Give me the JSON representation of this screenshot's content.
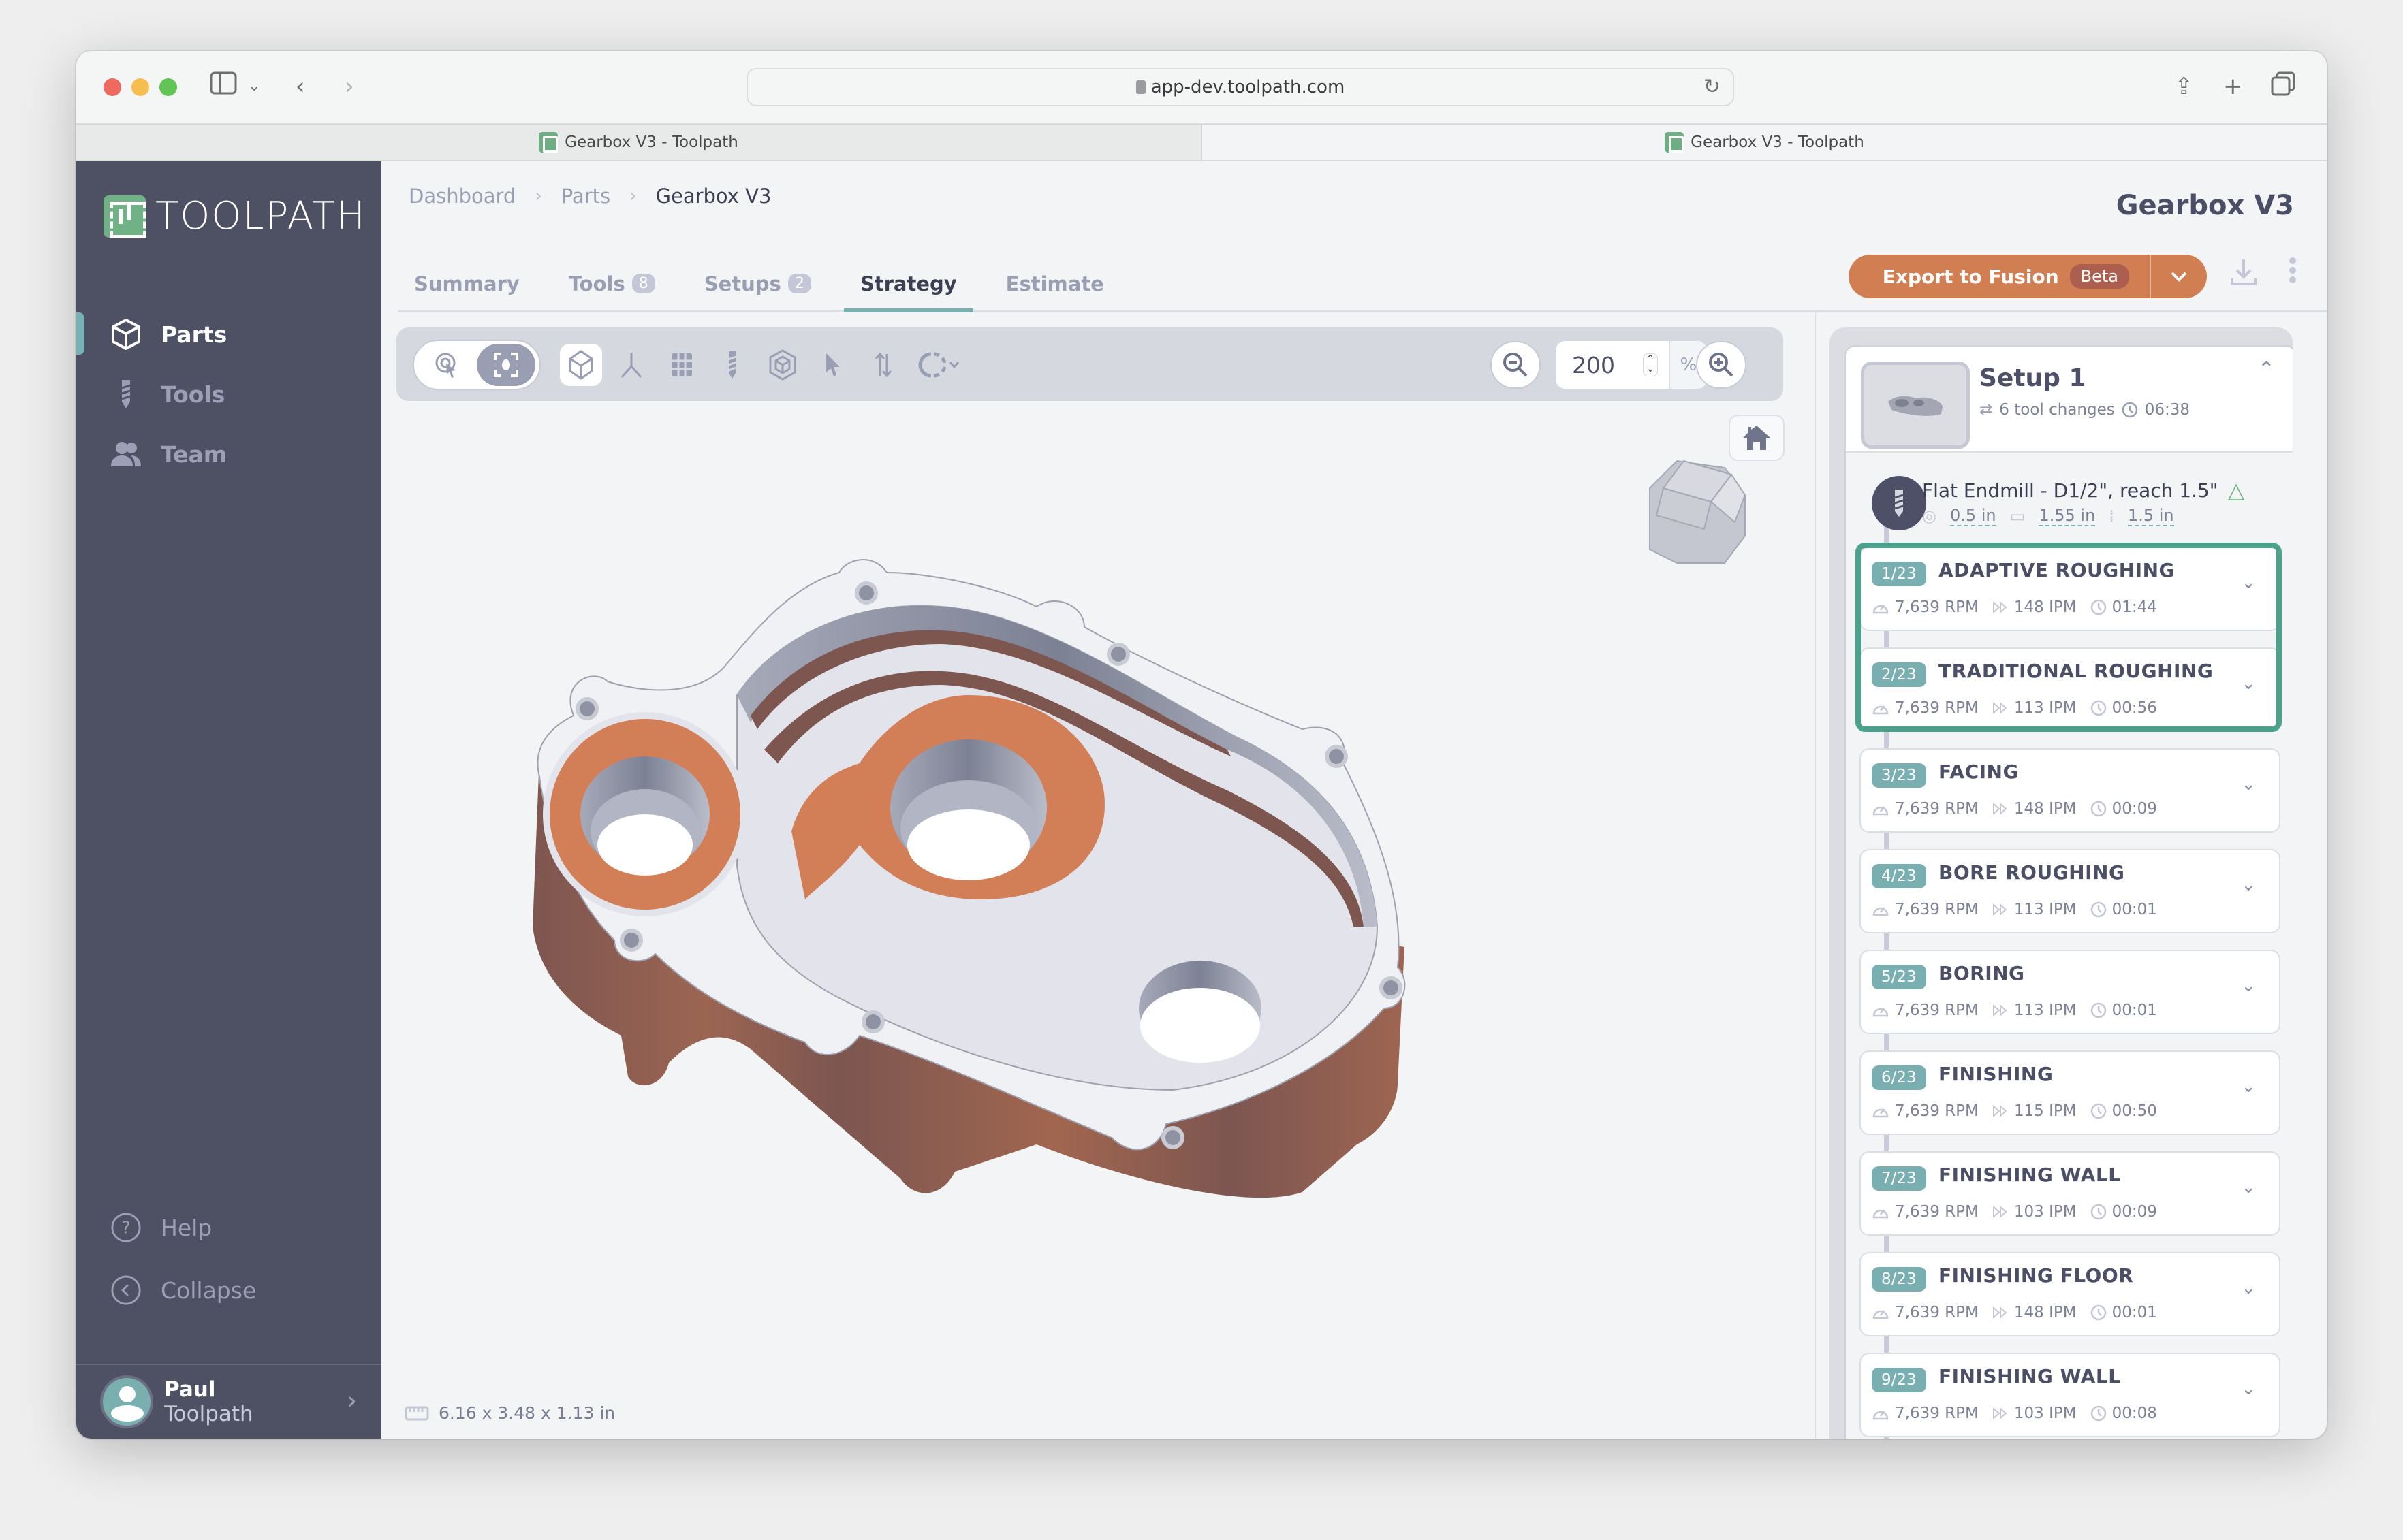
{
  "browser": {
    "url": "app-dev.toolpath.com",
    "tabs": [
      {
        "title": "Gearbox V3 - Toolpath",
        "active": false
      },
      {
        "title": "Gearbox V3 - Toolpath",
        "active": true
      }
    ]
  },
  "sidebar": {
    "brand": "TOOLPATH",
    "items": [
      {
        "label": "Parts",
        "icon": "cube-icon",
        "active": true
      },
      {
        "label": "Tools",
        "icon": "drill-bit-icon",
        "active": false
      },
      {
        "label": "Team",
        "icon": "users-icon",
        "active": false
      }
    ],
    "bottom_items": [
      {
        "label": "Help",
        "icon": "question-circle-icon"
      },
      {
        "label": "Collapse",
        "icon": "chevron-left-circle-icon"
      }
    ],
    "user": {
      "name": "Paul",
      "org": "Toolpath"
    }
  },
  "header": {
    "breadcrumb": [
      "Dashboard",
      "Parts",
      "Gearbox V3"
    ],
    "title": "Gearbox V3",
    "tabs": [
      {
        "label": "Summary",
        "count": null,
        "active": false
      },
      {
        "label": "Tools",
        "count": "8",
        "active": false
      },
      {
        "label": "Setups",
        "count": "2",
        "active": false
      },
      {
        "label": "Strategy",
        "count": null,
        "active": true
      },
      {
        "label": "Estimate",
        "count": null,
        "active": false
      }
    ],
    "export_label": "Export to Fusion",
    "export_badge": "Beta"
  },
  "viewer": {
    "zoom_value": "200",
    "zoom_unit": "%",
    "dimensions": "6.16 x 3.48 x 1.13 in",
    "toolbar_icons": [
      "select-orbit-icon",
      "fit-view-icon",
      "iso-cube-icon",
      "axes-icon",
      "grid-icon",
      "tool-icon",
      "stock-icon",
      "pointer-icon",
      "flip-axis-icon",
      "rotate-icon"
    ]
  },
  "setup": {
    "title": "Setup 1",
    "tool_changes": "6 tool changes",
    "duration": "06:38",
    "tool": {
      "name": "Flat Endmill - D1/2\", reach 1.5\"",
      "diameter": "0.5 in",
      "length": "1.55 in",
      "reach": "1.5 in"
    },
    "operations": [
      {
        "index": "1/23",
        "name": "ADAPTIVE ROUGHING",
        "rpm": "7,639 RPM",
        "feed": "148 IPM",
        "time": "01:44",
        "selected": true
      },
      {
        "index": "2/23",
        "name": "TRADITIONAL ROUGHING",
        "rpm": "7,639 RPM",
        "feed": "113 IPM",
        "time": "00:56",
        "selected": true
      },
      {
        "index": "3/23",
        "name": "FACING",
        "rpm": "7,639 RPM",
        "feed": "148 IPM",
        "time": "00:09",
        "selected": false
      },
      {
        "index": "4/23",
        "name": "BORE ROUGHING",
        "rpm": "7,639 RPM",
        "feed": "113 IPM",
        "time": "00:01",
        "selected": false
      },
      {
        "index": "5/23",
        "name": "BORING",
        "rpm": "7,639 RPM",
        "feed": "113 IPM",
        "time": "00:01",
        "selected": false
      },
      {
        "index": "6/23",
        "name": "FINISHING",
        "rpm": "7,639 RPM",
        "feed": "115 IPM",
        "time": "00:50",
        "selected": false
      },
      {
        "index": "7/23",
        "name": "FINISHING WALL",
        "rpm": "7,639 RPM",
        "feed": "103 IPM",
        "time": "00:09",
        "selected": false
      },
      {
        "index": "8/23",
        "name": "FINISHING FLOOR",
        "rpm": "7,639 RPM",
        "feed": "148 IPM",
        "time": "00:01",
        "selected": false
      },
      {
        "index": "9/23",
        "name": "FINISHING WALL",
        "rpm": "7,639 RPM",
        "feed": "103 IPM",
        "time": "00:08",
        "selected": false
      }
    ]
  },
  "colors": {
    "sidebar_bg": "#4e5064",
    "accent_teal": "#78afb1",
    "selection_green": "#4aa28c",
    "export_orange": "#d07e52",
    "brand_green": "#70b285"
  }
}
